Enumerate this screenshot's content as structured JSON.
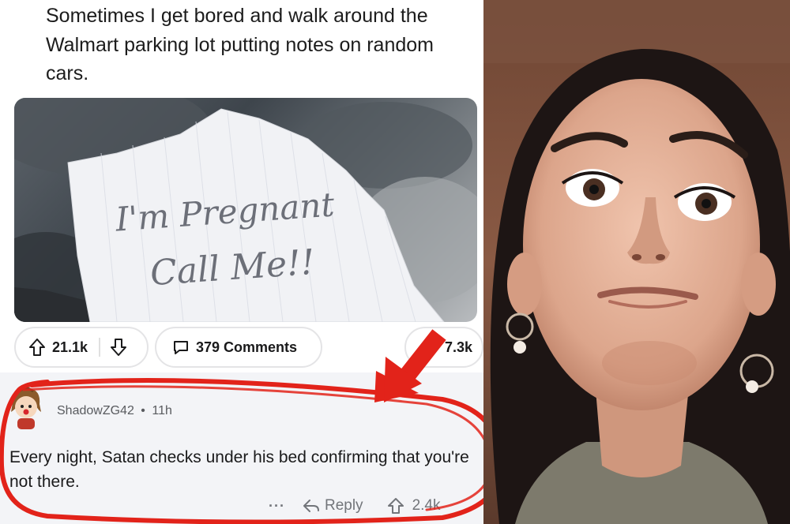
{
  "post": {
    "title": "Sometimes I get bored and walk around the Walmart parking lot putting notes on random cars.",
    "note_line1": "I'm Pregnant",
    "note_line2": "Call Me!!",
    "upvotes": "21.1k",
    "comments": "379 Comments",
    "shares": "7.3k"
  },
  "comment": {
    "username": "ShadowZG42",
    "separator": "•",
    "age": "11h",
    "body": "Every night, Satan checks under his bed confirming that you're not there.",
    "more": "···",
    "reply_label": "Reply",
    "votes": "2.4k"
  },
  "colors": {
    "annotation_red": "#e2231a",
    "comment_bg": "#f3f4f7",
    "pill_border": "#e4e4e6"
  },
  "icons": {
    "upvote": "arrow-up-outline",
    "downvote": "arrow-down-outline",
    "comments": "speech-bubble",
    "reply": "reply-arrow"
  }
}
